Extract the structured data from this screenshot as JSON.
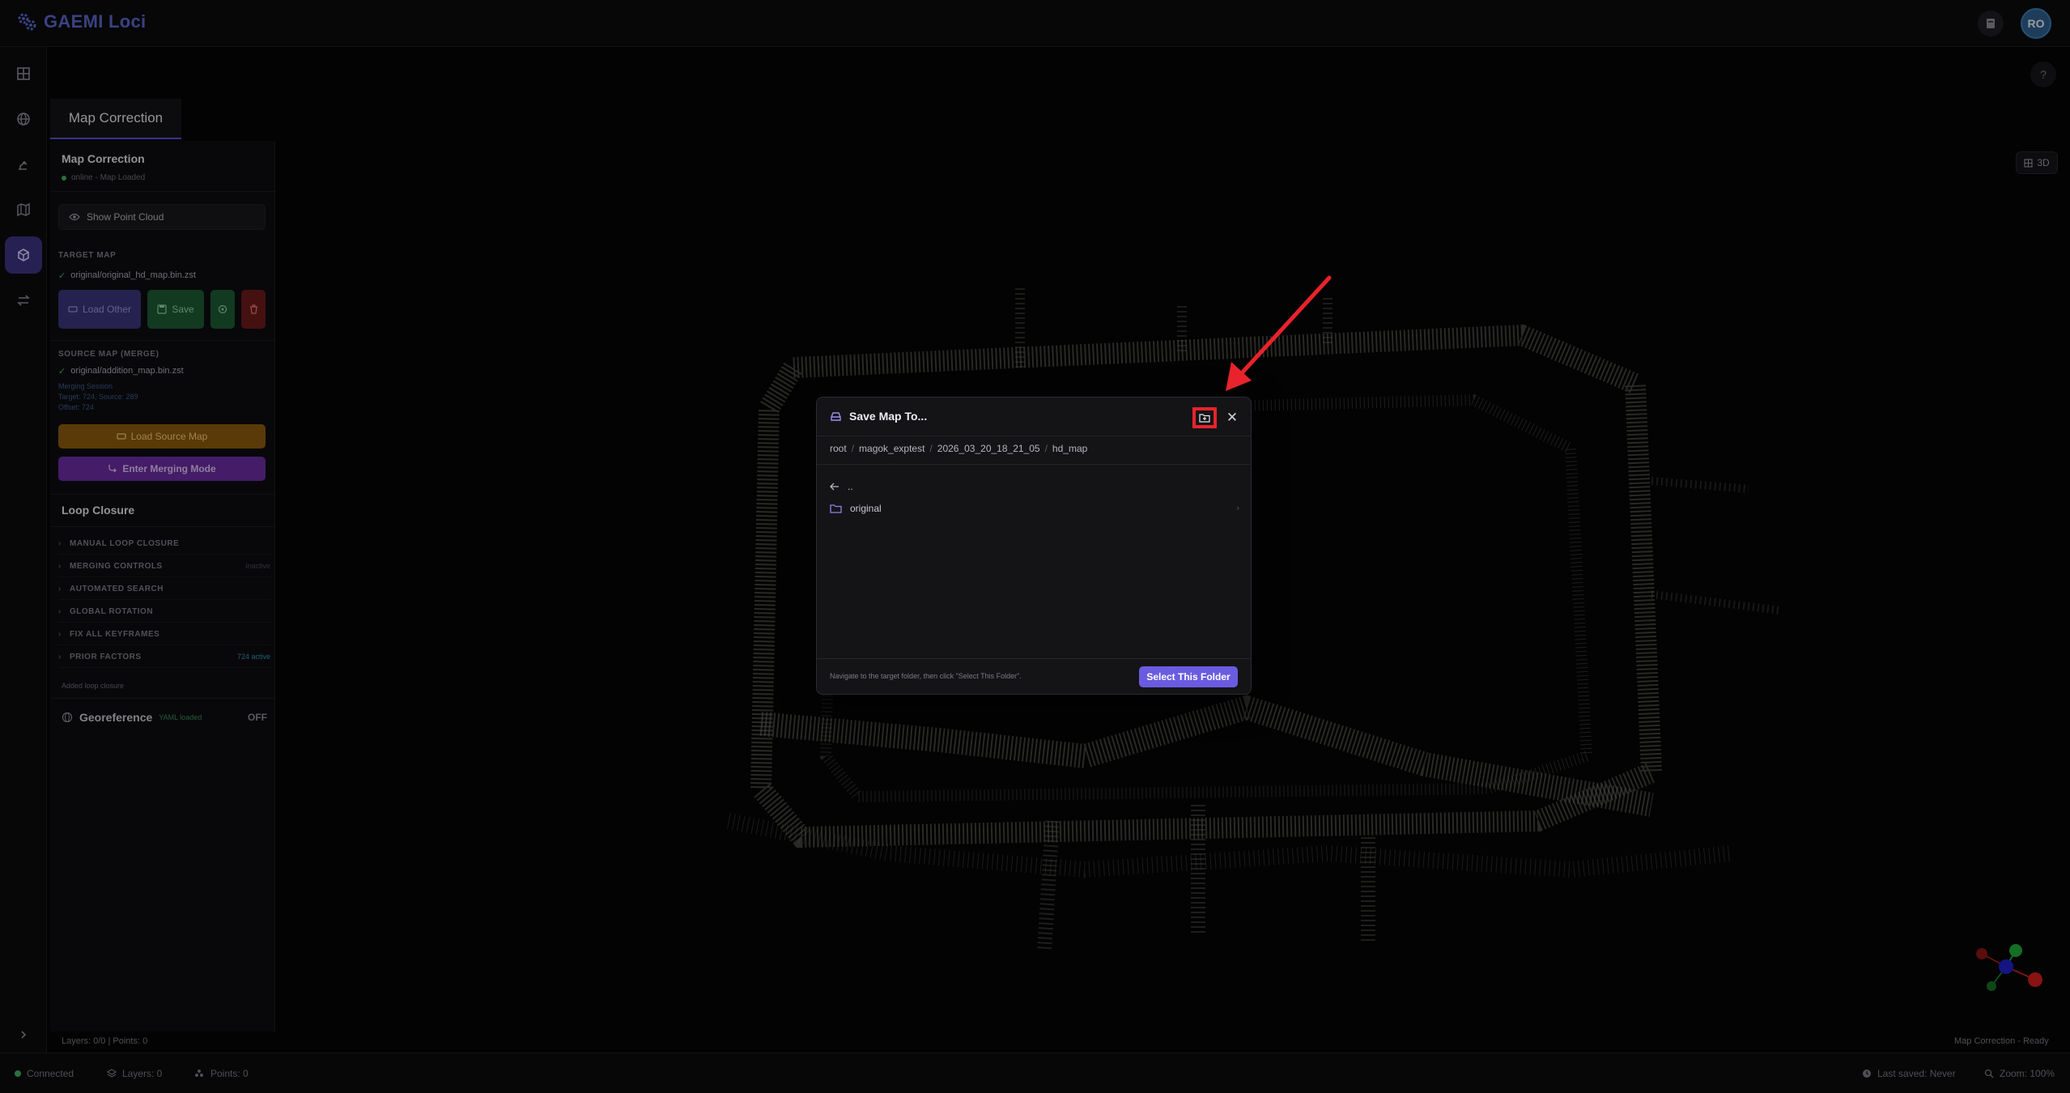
{
  "app": {
    "title": "GAEMI Loci",
    "avatar_initials": "RO"
  },
  "tab": {
    "label": "Map Correction"
  },
  "help": {
    "label": "?"
  },
  "view_toggle": {
    "label": "3D"
  },
  "panel": {
    "title": "Map Correction",
    "status": "online - Map Loaded",
    "show_point_cloud": "Show Point Cloud",
    "target_map": {
      "label": "TARGET MAP",
      "file": "original/original_hd_map.bin.zst",
      "load_other": "Load Other",
      "save": "Save"
    },
    "source_map": {
      "label": "SOURCE MAP (MERGE)",
      "file": "original/addition_map.bin.zst",
      "line1": "Merging Session",
      "line2": "Target: 724, Source: 289",
      "line3": "Offset: 724",
      "load_source": "Load Source Map",
      "enter_merging": "Enter Merging Mode"
    },
    "loop_closure": {
      "title": "Loop Closure",
      "items": [
        {
          "label": "MANUAL LOOP CLOSURE",
          "right": ""
        },
        {
          "label": "MERGING CONTROLS",
          "right": "inactive"
        },
        {
          "label": "AUTOMATED SEARCH",
          "right": ""
        },
        {
          "label": "GLOBAL ROTATION",
          "right": ""
        },
        {
          "label": "FIX ALL KEYFRAMES",
          "right": ""
        },
        {
          "label": "PRIOR FACTORS",
          "right": "724 active"
        }
      ],
      "footer": "Added loop closure"
    },
    "georeference": {
      "label": "Georeference",
      "badge": "YAML loaded",
      "state": "OFF"
    }
  },
  "viewport": {
    "layers_info": "Layers: 0/0 | Points: 0",
    "status": "Map Correction - Ready"
  },
  "statusbar": {
    "connected": "Connected",
    "layers": "Layers: 0",
    "points": "Points: 0",
    "last_saved": "Last saved: Never",
    "zoom": "Zoom: 100%"
  },
  "modal": {
    "title": "Save Map To...",
    "breadcrumb": [
      "root",
      "magok_exptest",
      "2026_03_20_18_21_05",
      "hd_map"
    ],
    "parent": "..",
    "folders": [
      "original"
    ],
    "hint": "Navigate to the target folder, then click \"Select This Folder\".",
    "select_button": "Select This Folder"
  },
  "colors": {
    "accent": "#6a5ce0",
    "brand": "#5a66c8",
    "save_green": "#1d5a33",
    "delete_red": "#6a1a1a",
    "source_orange": "#8a5a0e",
    "merge_purple": "#6a2c9e",
    "annotation_red": "#e8232b"
  }
}
